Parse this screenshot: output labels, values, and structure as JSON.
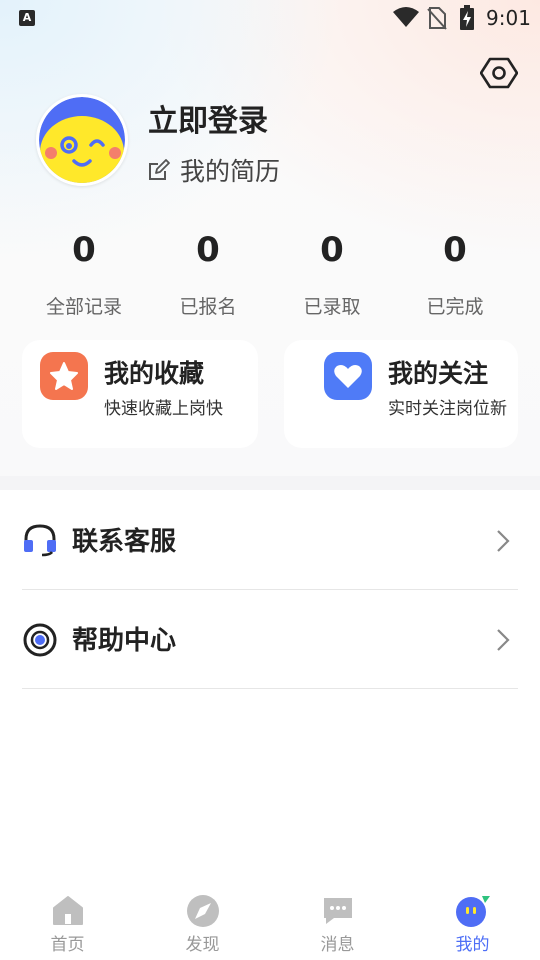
{
  "status_bar": {
    "time": "9:01",
    "app_badge": "A"
  },
  "profile": {
    "login_text": "立即登录",
    "resume_text": "我的简历"
  },
  "stats": [
    {
      "value": "0",
      "label": "全部记录"
    },
    {
      "value": "0",
      "label": "已报名"
    },
    {
      "value": "0",
      "label": "已录取"
    },
    {
      "value": "0",
      "label": "已完成"
    }
  ],
  "cards": [
    {
      "title": "我的收藏",
      "subtitle": "快速收藏上岗快",
      "icon": "star-icon",
      "color": "#f4754f"
    },
    {
      "title": "我的关注",
      "subtitle": "实时关注岗位新",
      "icon": "heart-icon",
      "color": "#4f7bf7"
    }
  ],
  "menu": [
    {
      "label": "联系客服",
      "icon": "headset-icon"
    },
    {
      "label": "帮助中心",
      "icon": "help-target-icon"
    }
  ],
  "bottom_nav": [
    {
      "label": "首页",
      "icon": "home-icon",
      "active": false
    },
    {
      "label": "发现",
      "icon": "compass-icon",
      "active": false
    },
    {
      "label": "消息",
      "icon": "message-icon",
      "active": false
    },
    {
      "label": "我的",
      "icon": "profile-face-icon",
      "active": true
    }
  ],
  "colors": {
    "accent": "#4d6ef6",
    "inactive": "#999999",
    "collect": "#f4754f",
    "follow": "#4f7bf7"
  }
}
